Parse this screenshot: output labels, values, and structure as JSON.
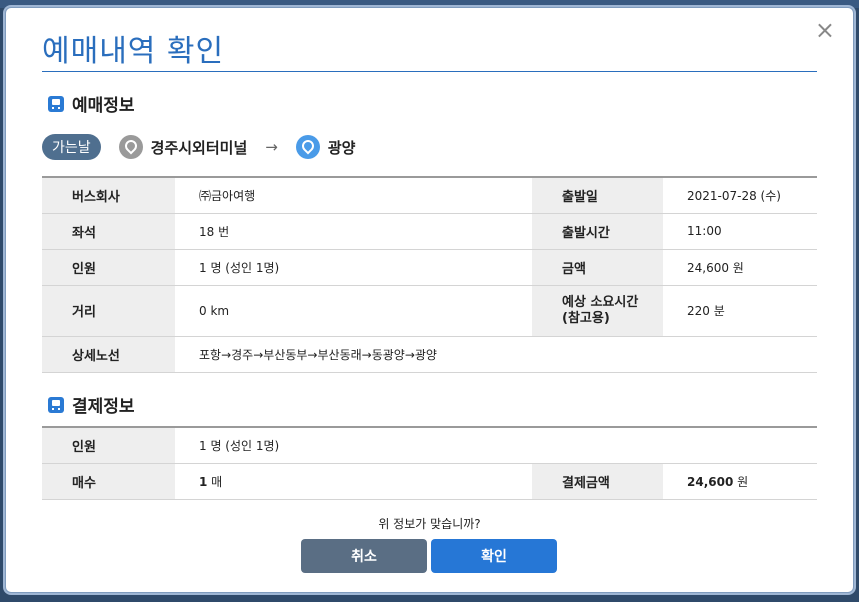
{
  "dialog": {
    "title": "예매내역 확인",
    "close_label": "×"
  },
  "reservation": {
    "heading": "예매정보",
    "trip_badge": "가는날",
    "origin": "경주시외터미널",
    "arrow": "→",
    "destination": "광양",
    "rows": [
      {
        "label": "버스회사",
        "value": "㈜금아여행",
        "label2": "출발일",
        "value2": "2021-07-28 (수)"
      },
      {
        "label": "좌석",
        "value": "18 번",
        "label2": "출발시간",
        "value2": "11:00"
      },
      {
        "label": "인원",
        "value": "1 명 (성인 1명)",
        "label2": "금액",
        "value2": "24,600 원"
      },
      {
        "label": "거리",
        "value": "0 km",
        "label2": "예상 소요시간\n(참고용)",
        "value2": "220 분"
      },
      {
        "label": "상세노선",
        "value": "포항→경주→부산동부→부산동래→동광양→광양"
      }
    ]
  },
  "payment": {
    "heading": "결제정보",
    "people_label": "인원",
    "people_value": "1 명 (성인 1명)",
    "count_label": "매수",
    "count_value": "1",
    "count_unit": " 매",
    "amount_label": "결제금액",
    "amount_value": "24,600",
    "amount_unit": " 원"
  },
  "footer": {
    "question": "위 정보가 맞습니까?",
    "cancel_label": "취소",
    "confirm_label": "확인"
  },
  "colors": {
    "accent": "#2a6ebd",
    "confirm_button": "#2677d6",
    "cancel_button": "#5a6e84"
  }
}
